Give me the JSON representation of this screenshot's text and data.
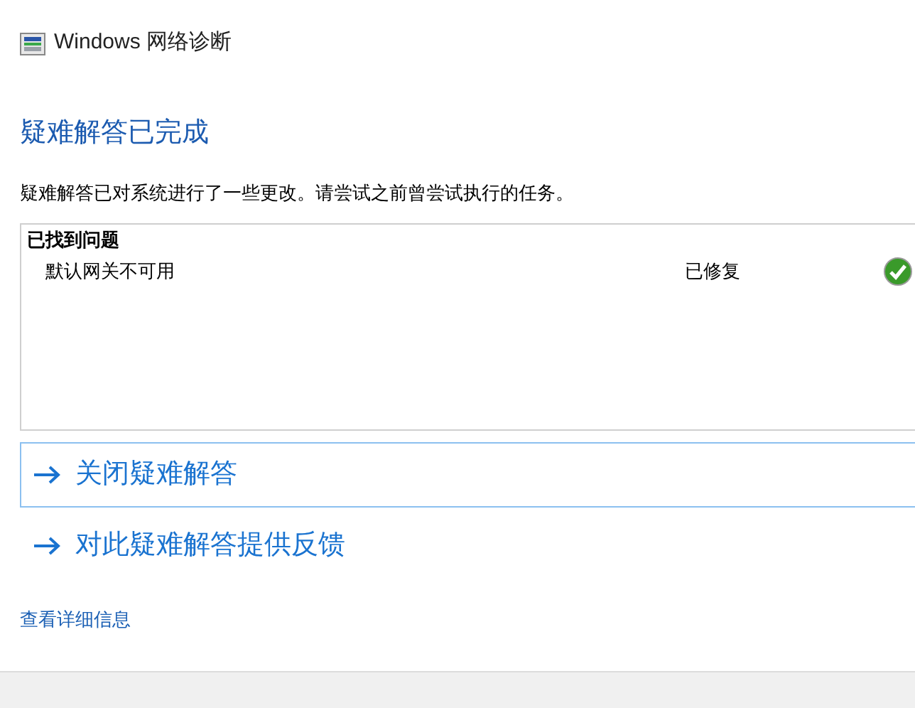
{
  "window": {
    "title": "Windows 网络诊断"
  },
  "heading": "疑难解答已完成",
  "description": "疑难解答已对系统进行了一些更改。请尝试之前曾尝试执行的任务。",
  "problems": {
    "header": "已找到问题",
    "items": [
      {
        "name": "默认网关不可用",
        "status": "已修复",
        "kind": "fixed"
      }
    ]
  },
  "actions": [
    {
      "label": "关闭疑难解答",
      "selected": true
    },
    {
      "label": "对此疑难解答提供反馈",
      "selected": false
    }
  ],
  "details_link": "查看详细信息"
}
